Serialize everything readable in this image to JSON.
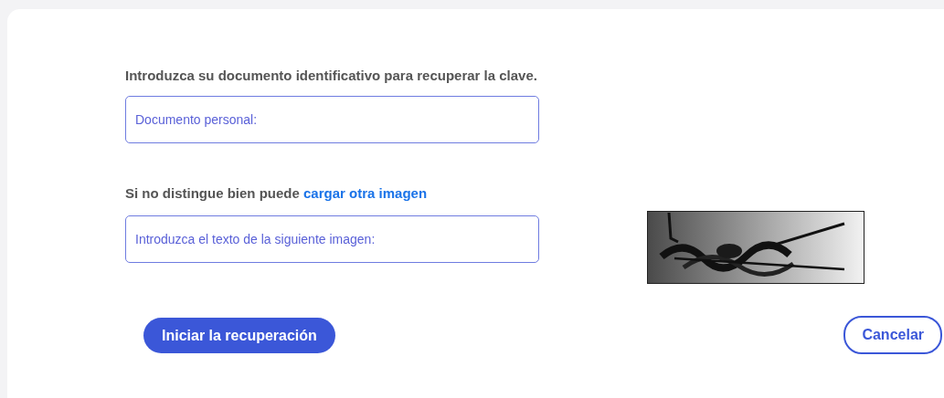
{
  "instruction": "Introduzca su documento identificativo para recuperar la clave.",
  "document_field": {
    "placeholder": "Documento personal:"
  },
  "reload_hint": {
    "text": "Si no distingue bien puede",
    "link": "cargar otra imagen"
  },
  "captcha_field": {
    "placeholder": "Introduzca el texto de la siguiente imagen:"
  },
  "buttons": [
    {
      "label": "Iniciar la recuperación",
      "kind": "primary"
    },
    {
      "label": "Cancelar",
      "kind": "secondary"
    }
  ]
}
